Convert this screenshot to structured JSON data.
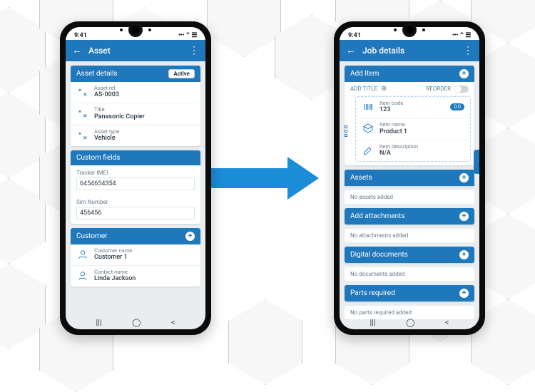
{
  "statusbar": {
    "time": "9:41",
    "right_glyphs": "••• ⌃ ☰"
  },
  "nav_gesture": {
    "recent": "|||",
    "home": "◯",
    "back": "<"
  },
  "left": {
    "appbar": {
      "title": "Asset"
    },
    "asset_details": {
      "title": "Asset details",
      "badge": "Active",
      "rows": [
        {
          "label": "Asset ref",
          "value": "AS-0003"
        },
        {
          "label": "Title",
          "value": "Panasonic Copier"
        },
        {
          "label": "Asset type",
          "value": "Vehicle"
        }
      ]
    },
    "custom_fields": {
      "title": "Custom fields",
      "fields": [
        {
          "label": "Tracker IMEI",
          "value": "6454654354"
        },
        {
          "label": "Sim Number",
          "value": "456456"
        }
      ]
    },
    "customer": {
      "title": "Customer",
      "rows": [
        {
          "label": "Customer name",
          "value": "Customer 1"
        },
        {
          "label": "Contact name",
          "value": "Linda Jackson"
        }
      ]
    }
  },
  "right": {
    "appbar": {
      "title": "Job details"
    },
    "add_item": {
      "title": "Add Item",
      "add_title_label": "ADD TITLE",
      "reorder_label": "REORDER",
      "item": {
        "rows": [
          {
            "label": "Item code",
            "value": "123",
            "pill": "0.0"
          },
          {
            "label": "Item name",
            "value": "Product 1"
          },
          {
            "label": "Item description",
            "value": "N/A"
          }
        ]
      }
    },
    "assets": {
      "title": "Assets",
      "empty": "No assets added"
    },
    "attachments": {
      "title": "Add attachments",
      "empty": "No attachments added"
    },
    "digital_documents": {
      "title": "Digital documents",
      "empty": "No documents added"
    },
    "parts_required": {
      "title": "Parts required",
      "empty": "No parts required added"
    }
  }
}
